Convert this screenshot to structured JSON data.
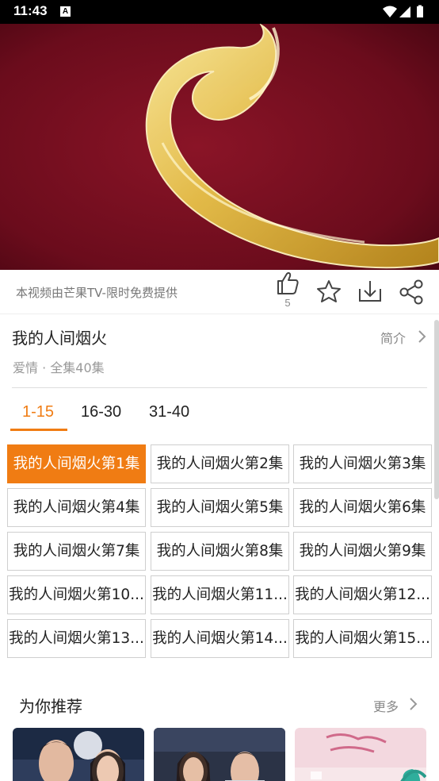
{
  "status_bar": {
    "time": "11:43",
    "notification_icon": "A"
  },
  "video": {
    "description": "mango-tv-logo-swirl"
  },
  "actions": {
    "notice": "本视频由芒果TV-限时免费提供",
    "like_count": "5"
  },
  "show": {
    "title": "我的人间烟火",
    "intro_label": "简介",
    "meta": "爱情 · 全集40集"
  },
  "tabs": [
    {
      "label": "1-15",
      "active": true
    },
    {
      "label": "16-30",
      "active": false
    },
    {
      "label": "31-40",
      "active": false
    }
  ],
  "episodes": [
    {
      "label": "我的人间烟火第1集",
      "active": true
    },
    {
      "label": "我的人间烟火第2集",
      "active": false
    },
    {
      "label": "我的人间烟火第3集",
      "active": false
    },
    {
      "label": "我的人间烟火第4集",
      "active": false
    },
    {
      "label": "我的人间烟火第5集",
      "active": false
    },
    {
      "label": "我的人间烟火第6集",
      "active": false
    },
    {
      "label": "我的人间烟火第7集",
      "active": false
    },
    {
      "label": "我的人间烟火第8集",
      "active": false
    },
    {
      "label": "我的人间烟火第9集",
      "active": false
    },
    {
      "label": "我的人间烟火第10...",
      "active": false
    },
    {
      "label": "我的人间烟火第11...",
      "active": false
    },
    {
      "label": "我的人间烟火第12...",
      "active": false
    },
    {
      "label": "我的人间烟火第13...",
      "active": false
    },
    {
      "label": "我的人间烟火第14...",
      "active": false
    },
    {
      "label": "我的人间烟火第15...",
      "active": false
    }
  ],
  "recommend": {
    "title": "为你推荐",
    "more_label": "更多"
  },
  "colors": {
    "accent": "#f07c13",
    "video_bg": "#6b0c1c",
    "logo_gold": "#e8c34a"
  }
}
